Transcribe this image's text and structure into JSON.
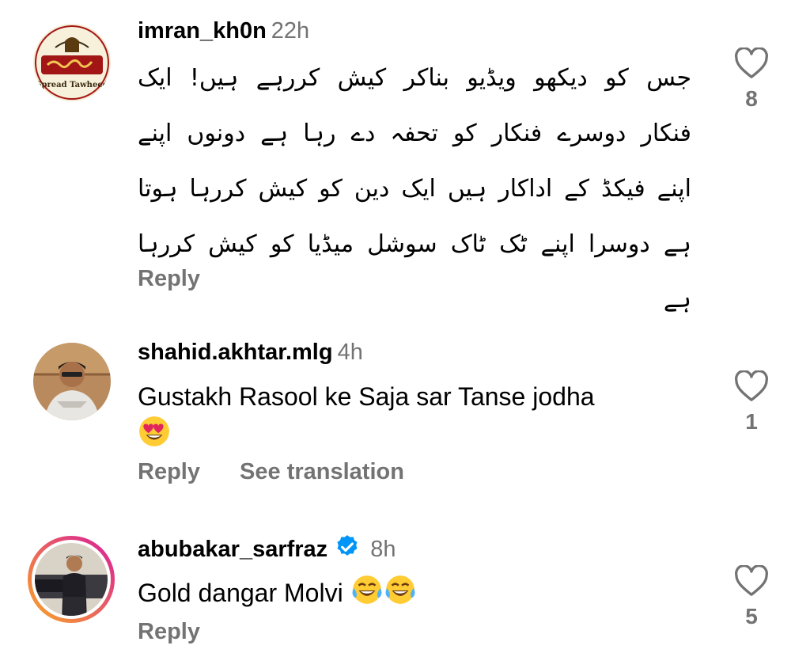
{
  "comments": [
    {
      "username": "imran_kh0n",
      "time": "22h",
      "text": "جس کو دیکھو ویڈیو بناکر کیش کررہے ہیں! ایک فنکار دوسرے فنکار کو تحفہ دے رہا ہے دونوں اپنے اپنے فیکڈ کے اداکار ہیں ایک دین کو کیش کررہا ہوتا ہے دوسرا اپنے ٹک ٹاک سوشل میڈیا کو کیش کررہا ہے",
      "reply_label": "Reply",
      "likes": "8",
      "avatar_text": "Spread Tawheed"
    },
    {
      "username": "shahid.akhtar.mlg",
      "time": "4h",
      "text": "Gustakh Rasool ke Saja sar Tanse jodha",
      "emoji": "heart-eyes",
      "reply_label": "Reply",
      "translate_label": "See translation",
      "likes": "1"
    },
    {
      "username": "abubakar_sarfraz",
      "time": "8h",
      "verified": true,
      "text": "Gold dangar Molvi",
      "emoji": "tears-of-joy x2",
      "reply_label": "Reply",
      "likes": "5"
    }
  ],
  "colors": {
    "secondary": "#737373",
    "verified": "#0095f6",
    "story_ring_start": "#f9a825",
    "story_ring_end": "#d81b9c"
  }
}
